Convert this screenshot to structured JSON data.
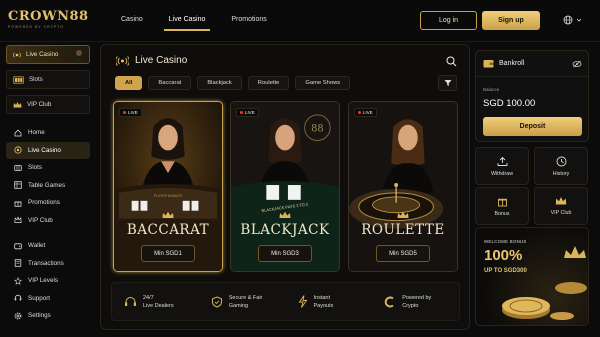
{
  "brand": {
    "name": "CROWN88",
    "tagline": "POWERED BY CRYPTO"
  },
  "topnav": {
    "items": [
      {
        "label": "Casino"
      },
      {
        "label": "Live Casino",
        "active": true
      },
      {
        "label": "Promotions"
      }
    ]
  },
  "auth": {
    "login": "Log in",
    "signup": "Sign up"
  },
  "sidebar": {
    "cards": [
      {
        "label": "Live Casino",
        "active": true
      },
      {
        "label": "Slots"
      },
      {
        "label": "VIP Club"
      }
    ],
    "menu": [
      {
        "label": "Home",
        "icon": "home-icon"
      },
      {
        "label": "Live Casino",
        "icon": "live-icon",
        "active": true
      },
      {
        "label": "Slots",
        "icon": "slots-icon"
      },
      {
        "label": "Table Games",
        "icon": "table-icon"
      },
      {
        "label": "Promotions",
        "icon": "gift-icon"
      },
      {
        "label": "VIP Club",
        "icon": "crown-icon"
      }
    ],
    "menu2": [
      {
        "label": "Wallet",
        "icon": "wallet-icon"
      },
      {
        "label": "Transactions",
        "icon": "transactions-icon"
      },
      {
        "label": "VIP Levels",
        "icon": "vip-levels-icon"
      },
      {
        "label": "Support",
        "icon": "support-icon"
      },
      {
        "label": "Settings",
        "icon": "settings-icon"
      }
    ]
  },
  "main": {
    "title": "Live Casino",
    "filters": [
      {
        "label": "All",
        "active": true
      },
      {
        "label": "Baccarat"
      },
      {
        "label": "Blackjack"
      },
      {
        "label": "Roulette"
      },
      {
        "label": "Game Shows"
      }
    ],
    "games": [
      {
        "live": "LIVE",
        "title": "BACCARAT",
        "min": "Min SGD1",
        "active": true,
        "table_text": "PLAYER    BANKER"
      },
      {
        "live": "LIVE",
        "title": "BLACKJACK",
        "min": "Min SGD3",
        "table_text": "BLACKJACK PAYS 3 TO 2",
        "sign": "88"
      },
      {
        "live": "LIVE",
        "title": "ROULETTE",
        "min": "Min SGD5"
      }
    ],
    "features": [
      {
        "line1": "24/7",
        "line2": "Live Dealers",
        "icon": "headset-icon"
      },
      {
        "line1": "Secure & Fair",
        "line2": "Gaming",
        "icon": "shield-icon"
      },
      {
        "line1": "Instant",
        "line2": "Payouts",
        "icon": "lightning-icon"
      },
      {
        "line1": "Powered by",
        "line2": "Crypto",
        "icon": "crypto-icon"
      }
    ]
  },
  "bankroll": {
    "title": "Bankroll",
    "balance_label": "Balance",
    "balance": "SGD 100.00",
    "deposit": "Deposit"
  },
  "quick": [
    {
      "label": "Withdraw",
      "icon": "withdraw-icon"
    },
    {
      "label": "History",
      "icon": "clock-icon"
    },
    {
      "label": "Bonus",
      "icon": "gift-icon"
    },
    {
      "label": "VIP Club",
      "icon": "crown-icon"
    }
  ],
  "promo": {
    "label": "WELCOME BONUS",
    "headline": "100%",
    "sub": "UP TO SGD300"
  },
  "colors": {
    "gold": "#d9b45a",
    "background": "#0b0b0c",
    "live_dot": "#e23b3b"
  }
}
